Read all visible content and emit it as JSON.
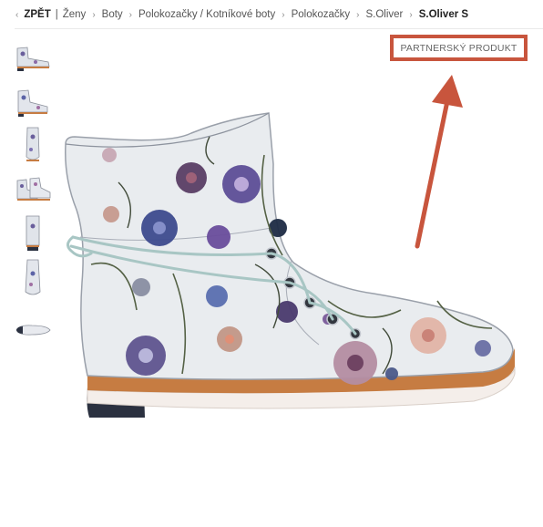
{
  "breadcrumb": {
    "back_label": "ZPĚT",
    "items": [
      "Ženy",
      "Boty",
      "Polokozačky / Kotníkové boty",
      "Polokozačky",
      "S.Oliver",
      "S.Oliver S"
    ]
  },
  "badge": {
    "label": "PARTNERSKÝ PRODUKT"
  },
  "gallery": {
    "thumbnail_count": 7,
    "thumbnail_views": [
      "side",
      "side-angled",
      "front",
      "pair",
      "back",
      "top",
      "sole"
    ]
  },
  "product_image": {
    "subject": "floral-print-lace-up-ankle-boot"
  },
  "colors": {
    "annotation_red": "#c8553d",
    "boot_base": "#e9ecef",
    "sole_welt": "#c67c42",
    "heel": "#2b3140"
  }
}
